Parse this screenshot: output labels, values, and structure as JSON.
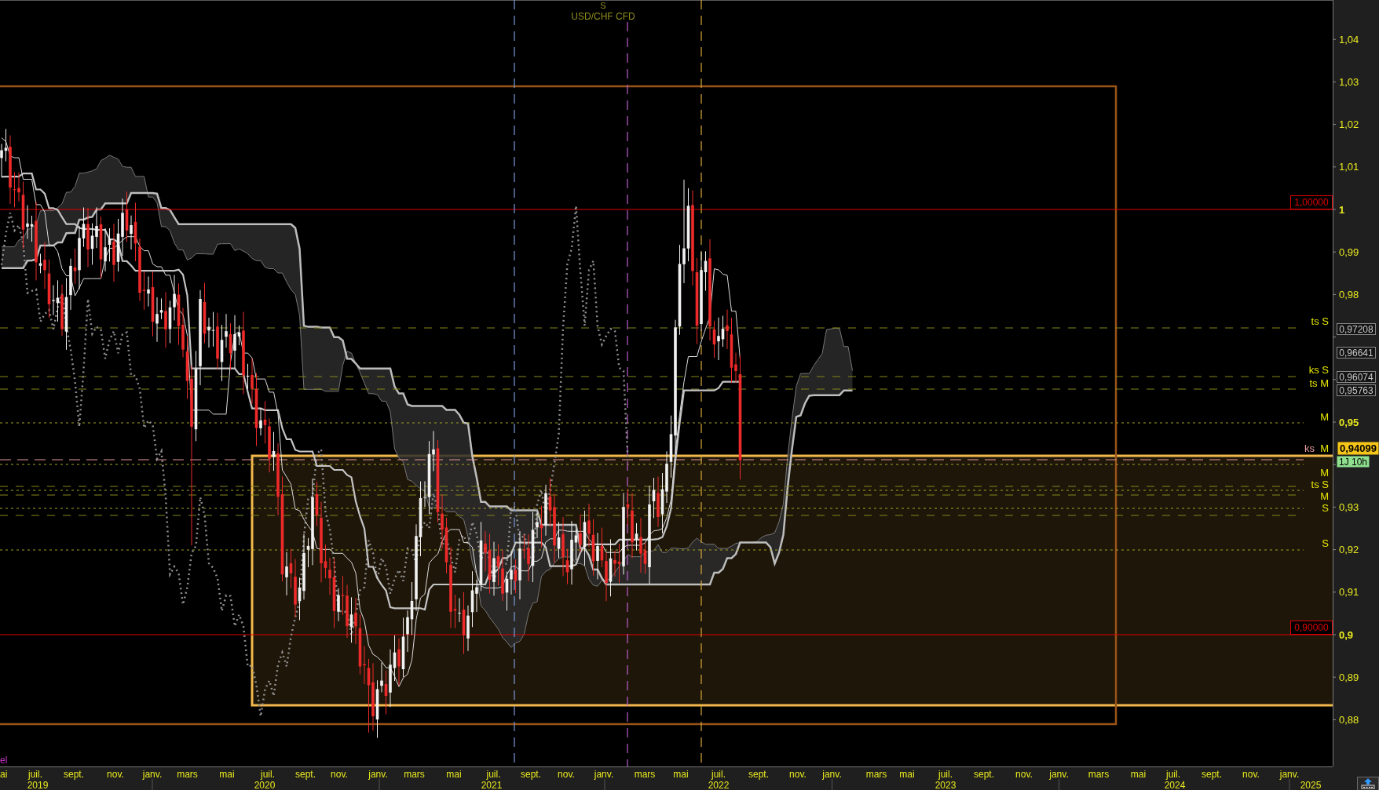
{
  "chart_title": {
    "code": "S",
    "instrument": "USD/CHF CFD"
  },
  "indicator_label": "el",
  "level_labels": [
    {
      "text": "ts S",
      "color": "#e6e600"
    },
    {
      "text": "ks S",
      "color": "#e6e600"
    },
    {
      "text": "ts M",
      "color": "#e6e600"
    },
    {
      "text": "M",
      "color": "#e6e600"
    },
    {
      "text": "ks",
      "color": "#e8a0a0"
    },
    {
      "text": "M",
      "color": "#e6e600"
    },
    {
      "text": "M",
      "color": "#e6e600"
    },
    {
      "text": "ts S",
      "color": "#e6e600"
    },
    {
      "text": "M",
      "color": "#e6e600"
    },
    {
      "text": "S",
      "color": "#e6e600"
    },
    {
      "text": "S",
      "color": "#e6e600"
    }
  ],
  "alerts": [
    {
      "price": "1,00000"
    },
    {
      "price": "0,90000"
    }
  ],
  "price_axis": {
    "ticks": [
      {
        "label": "1,04",
        "highlighted": false
      },
      {
        "label": "1,03",
        "highlighted": false
      },
      {
        "label": "1,02",
        "highlighted": false
      },
      {
        "label": "1,01",
        "highlighted": false
      },
      {
        "label": "1",
        "highlighted": true
      },
      {
        "label": "0,99",
        "highlighted": false
      },
      {
        "label": "0,98",
        "highlighted": false
      },
      {
        "label": "0,95",
        "highlighted": true
      },
      {
        "label": "0,93",
        "highlighted": false
      },
      {
        "label": "0,92",
        "highlighted": false
      },
      {
        "label": "0,91",
        "highlighted": false
      },
      {
        "label": "0,9",
        "highlighted": true
      },
      {
        "label": "0,89",
        "highlighted": false
      },
      {
        "label": "0,88",
        "highlighted": false
      }
    ],
    "tags": [
      {
        "text": "0,97208",
        "kind": "level"
      },
      {
        "text": "0,96641",
        "kind": "level"
      },
      {
        "text": "0,96074",
        "kind": "level"
      },
      {
        "text": "0,95763",
        "kind": "level"
      },
      {
        "text": "0,94099",
        "kind": "last_price"
      },
      {
        "text": "1J 10h",
        "kind": "countdown"
      }
    ]
  },
  "time_axis": {
    "months": [
      "ai",
      "juil.",
      "sept.",
      "nov.",
      "janv.",
      "mars",
      "mai",
      "juil.",
      "sept.",
      "nov.",
      "janv.",
      "mars",
      "mai",
      "juil.",
      "sept.",
      "nov.",
      "janv.",
      "mars",
      "mai",
      "juil.",
      "sept.",
      "nov.",
      "janv.",
      "mars",
      "mai",
      "juil.",
      "sept.",
      "nov.",
      "janv.",
      "mars",
      "mai",
      "juil.",
      "sept.",
      "nov.",
      "janv."
    ],
    "years": [
      "2019",
      "2020",
      "2021",
      "2022",
      "2023",
      "2024",
      "2025"
    ]
  }
}
